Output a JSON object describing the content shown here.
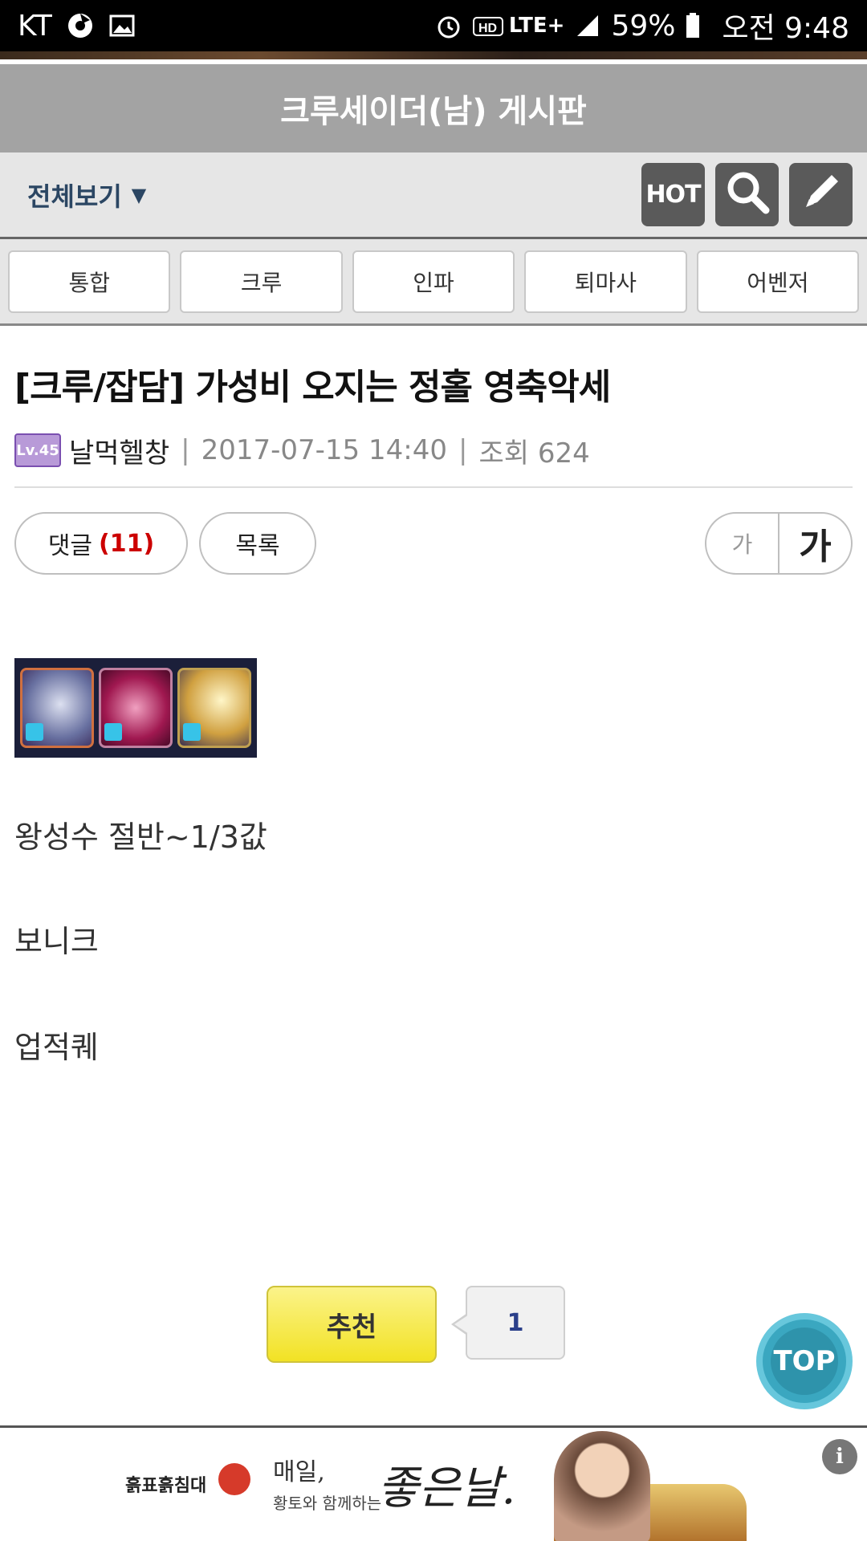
{
  "status_bar": {
    "carrier": "KT",
    "network": "LTE+",
    "battery": "59%",
    "time": "오전 9:48",
    "icons": [
      "chrome-icon",
      "gallery-icon",
      "alarm-icon",
      "hd-icon",
      "signal-icon",
      "battery-icon"
    ]
  },
  "board": {
    "title": "크루세이더(남) 게시판",
    "filter_label": "전체보기",
    "filter_caret": "▼",
    "hot_label": "HOT"
  },
  "tabs": [
    {
      "label": "통합"
    },
    {
      "label": "크루"
    },
    {
      "label": "인파"
    },
    {
      "label": "퇴마사"
    },
    {
      "label": "어벤저"
    }
  ],
  "post": {
    "title": "[크루/잡담] 가성비 오지는 정홀 영축악세",
    "level_badge": "Lv.45",
    "author": "날먹헬창",
    "date": "2017-07-15 14:40",
    "views_label": "조회 624",
    "body": [
      "왕성수 절반~1/3값",
      "보니크",
      "업적퀘"
    ]
  },
  "actions": {
    "comments_label": "댓글",
    "comments_count": "(11)",
    "list_label": "목록",
    "font_small": "가",
    "font_large": "가"
  },
  "recommend": {
    "label": "추천",
    "count": "1"
  },
  "top_button": "TOP",
  "ad": {
    "brand": "흙표흙침대",
    "line1": "매일,",
    "line2": "황토와 함께하는",
    "signature": "좋은날.",
    "info": "i"
  },
  "colors": {
    "title_bar": "#a3a3a3",
    "toolbar": "#e6e6e6",
    "filter_text": "#2b4663",
    "comment_count": "#cc0000",
    "recommend": "#f2e224",
    "top_button": "#3aa7c0"
  }
}
